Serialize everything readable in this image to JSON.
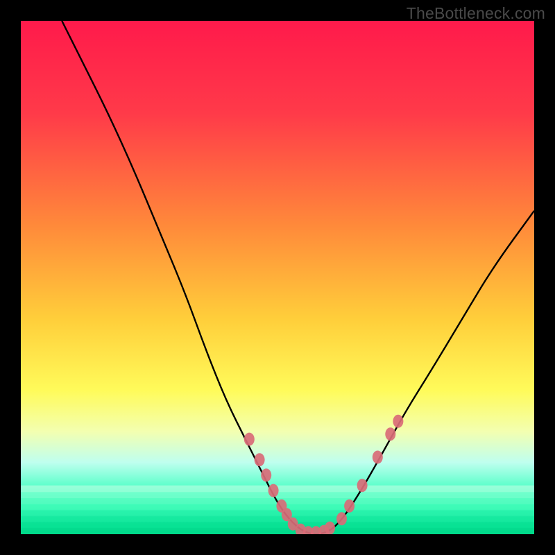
{
  "watermark": "TheBottleneck.com",
  "chart_data": {
    "type": "line",
    "title": "",
    "xlabel": "",
    "ylabel": "",
    "xlim": [
      0,
      100
    ],
    "ylim": [
      0,
      100
    ],
    "grid": false,
    "note": "No axis tick labels are rendered; values are normalized percentages read from the plot area.",
    "gradient_stops": [
      {
        "offset": 0,
        "color": "#ff1a4b"
      },
      {
        "offset": 18,
        "color": "#ff3a49"
      },
      {
        "offset": 40,
        "color": "#ff8a3a"
      },
      {
        "offset": 58,
        "color": "#ffce3a"
      },
      {
        "offset": 72,
        "color": "#fffb5a"
      },
      {
        "offset": 80,
        "color": "#f3ffb0"
      },
      {
        "offset": 86,
        "color": "#bfffef"
      },
      {
        "offset": 92,
        "color": "#3fffc0"
      },
      {
        "offset": 100,
        "color": "#00e28a"
      }
    ],
    "curve_points": [
      {
        "x": 8,
        "y": 100
      },
      {
        "x": 12,
        "y": 92
      },
      {
        "x": 17,
        "y": 82
      },
      {
        "x": 22,
        "y": 71
      },
      {
        "x": 27,
        "y": 59
      },
      {
        "x": 32,
        "y": 47
      },
      {
        "x": 36,
        "y": 36
      },
      {
        "x": 40,
        "y": 26
      },
      {
        "x": 44,
        "y": 18
      },
      {
        "x": 47,
        "y": 12
      },
      {
        "x": 50,
        "y": 6
      },
      {
        "x": 53,
        "y": 2
      },
      {
        "x": 56,
        "y": 0
      },
      {
        "x": 59,
        "y": 0
      },
      {
        "x": 62,
        "y": 2
      },
      {
        "x": 66,
        "y": 8
      },
      {
        "x": 70,
        "y": 15
      },
      {
        "x": 75,
        "y": 24
      },
      {
        "x": 80,
        "y": 32
      },
      {
        "x": 86,
        "y": 42
      },
      {
        "x": 92,
        "y": 52
      },
      {
        "x": 100,
        "y": 63
      }
    ],
    "markers": [
      {
        "x": 44.5,
        "y": 18.5
      },
      {
        "x": 46.5,
        "y": 14.5
      },
      {
        "x": 47.8,
        "y": 11.5
      },
      {
        "x": 49.2,
        "y": 8.5
      },
      {
        "x": 50.8,
        "y": 5.5
      },
      {
        "x": 51.8,
        "y": 3.8
      },
      {
        "x": 53.0,
        "y": 2.0
      },
      {
        "x": 54.5,
        "y": 0.8
      },
      {
        "x": 56.0,
        "y": 0.3
      },
      {
        "x": 57.5,
        "y": 0.3
      },
      {
        "x": 59.0,
        "y": 0.5
      },
      {
        "x": 60.2,
        "y": 1.2
      },
      {
        "x": 62.5,
        "y": 3.0
      },
      {
        "x": 64.0,
        "y": 5.5
      },
      {
        "x": 66.5,
        "y": 9.5
      },
      {
        "x": 69.5,
        "y": 15.0
      },
      {
        "x": 72.0,
        "y": 19.5
      },
      {
        "x": 73.5,
        "y": 22.0
      }
    ],
    "marker_color": "#d96b77",
    "curve_color": "#000000"
  }
}
